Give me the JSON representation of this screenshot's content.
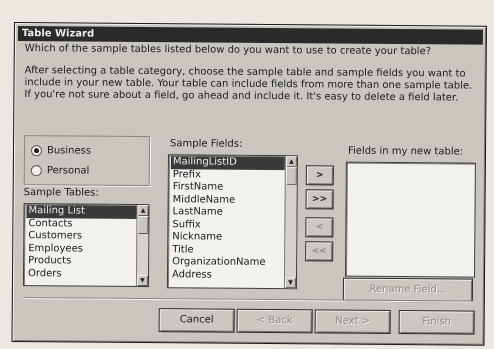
{
  "window": {
    "title": "Table Wizard"
  },
  "intro": {
    "question": "Which of the sample tables listed below do you want to use to create your table?",
    "details": "After selecting a table category, choose the sample table and sample fields you want to include in your new table. Your table can include fields from more than one sample table. If you're not sure about a field, go ahead and include it. It's easy to delete a field later."
  },
  "category": {
    "business_label": "Business",
    "personal_label": "Personal",
    "selected": "Business"
  },
  "sample_tables": {
    "label": "Sample Tables:",
    "items": [
      "Mailing List",
      "Contacts",
      "Customers",
      "Employees",
      "Products",
      "Orders"
    ],
    "selected": "Mailing List"
  },
  "sample_fields": {
    "label": "Sample Fields:",
    "items": [
      "MailingListID",
      "Prefix",
      "FirstName",
      "MiddleName",
      "LastName",
      "Suffix",
      "Nickname",
      "Title",
      "OrganizationName",
      "Address"
    ],
    "selected": "MailingListID"
  },
  "move_buttons": {
    "add_one": ">",
    "add_all": ">>",
    "remove_one": "<",
    "remove_all": "<<"
  },
  "new_fields": {
    "label": "Fields in my new table:",
    "items": []
  },
  "buttons": {
    "rename_field": "Rename Field...",
    "cancel": "Cancel",
    "back": "< Back",
    "next": "Next >",
    "finish": "Finish"
  },
  "colors": {
    "selection": "#3a3a3a",
    "face": "#c9c6c0",
    "titlebar": "#2a2a2a"
  }
}
